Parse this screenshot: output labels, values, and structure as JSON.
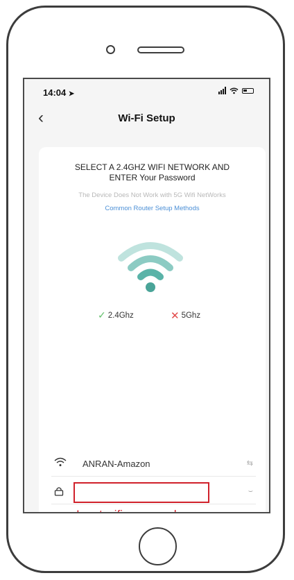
{
  "status_bar": {
    "time": "14:04"
  },
  "nav": {
    "title": "Wi-Fi Setup",
    "back_glyph": "‹"
  },
  "card": {
    "headline_line1": "SELECT A 2.4GHZ WIFI NETWORK AND",
    "headline_line2": "ENTER Your Password",
    "warning": "The Device Does Not Work with 5G Wifi NetWorks",
    "link": "Common Router Setup Methods",
    "band_ok": "2.4Ghz",
    "band_bad": "5Ghz",
    "ssid": "ANRAN-Amazon",
    "password_value": "",
    "annotation": "Input wifi password",
    "next_label": ""
  },
  "colors": {
    "accent": "#5faee3",
    "wifi_art": "#5ab3a8",
    "highlight": "#d0202a"
  },
  "icons": [
    "location-arrow-icon",
    "signal-icon",
    "wifi-icon",
    "battery-icon",
    "back-chevron-icon",
    "check-icon",
    "cross-icon",
    "lock-icon",
    "swap-icon",
    "eye-icon",
    "tap-hand-icon"
  ]
}
